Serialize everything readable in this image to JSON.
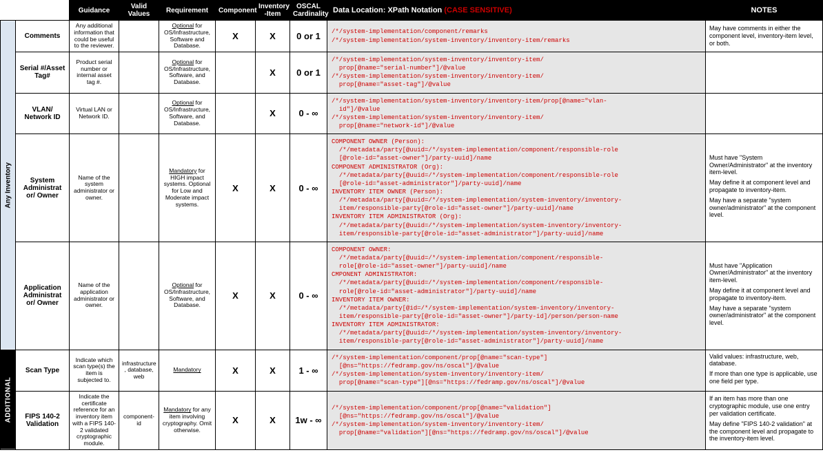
{
  "headers": {
    "guidance": "Guidance",
    "valid": "Valid Values",
    "req": "Requirement",
    "comp": "Component",
    "inv": "Inventory -Item",
    "card": "OSCAL Cardinality",
    "xpath_prefix": "Data Location: XPath Notation ",
    "xpath_cs": "(CASE SENSITIVE)",
    "notes": "NOTES"
  },
  "side": {
    "any": "Any Inventory",
    "add": "ADDITIONAL"
  },
  "rows": {
    "comments": {
      "name": "Comments",
      "guidance": "Any additional information that could be useful to the reviewer.",
      "valid": "",
      "req_u": "Optional",
      "req_rest": " for OS/Infrastructure, Software and Database.",
      "comp": "X",
      "inv": "X",
      "card": "0 or 1",
      "xpath": "/*/system-implementation/component/remarks\n/*/system-implementation/system-inventory/inventory-item/remarks",
      "notes": "May have comments in either the component level, inventory-item level, or both."
    },
    "serial": {
      "name": "Serial #/Asset Tag#",
      "guidance": "Product serial number or internal asset tag #.",
      "valid": "",
      "req_u": "Optional",
      "req_rest": " for OS/Infrastructure, Software, and Database.",
      "comp": "",
      "inv": "X",
      "card": "0 or 1",
      "xpath": "/*/system-implementation/system-inventory/inventory-item/\n  prop[@name=\"serial-number\"]/@value\n/*/system-implementation/system-inventory/inventory-item/\n  prop[@name=\"asset-tag\"]/@value",
      "notes": ""
    },
    "vlan": {
      "name": "VLAN/ Network ID",
      "guidance": "Virtual LAN or Network ID.",
      "valid": "",
      "req_u": "Optional",
      "req_rest": " for OS/Infrastructure, Software, and Database.",
      "comp": "",
      "inv": "X",
      "card": "0 - ∞",
      "xpath": "/*/system-implementation/system-inventory/inventory-item/prop[@name=\"vlan-\n  id\"]/@value\n/*/system-implementation/system-inventory/inventory-item/\n  prop[@name=\"network-id\"]/@value",
      "notes": ""
    },
    "sysadmin": {
      "name": "System Administrat or/ Owner",
      "guidance": "Name of the system administrator or owner.",
      "valid": "",
      "req_u": "Mandatory",
      "req_rest": " for HIGH impact systems. Optional for Low and Moderate impact systems.",
      "comp": "X",
      "inv": "X",
      "card": "0 - ∞",
      "xpath": "COMPONENT OWNER (Person):\n  /*/metadata/party[@uuid=/*/system-implementation/component/responsible-role\n  [@role-id=\"asset-owner\"]/party-uuid]/name\nCOMPONENT ADMINISTRATOR (Org):\n  /*/metadata/party[@uuid=/*/system-implementation/component/responsible-role\n  [@role-id=\"asset-administrator\"]/party-uuid]/name\nINVENTORY ITEM OWNER (Person):\n  /*/metadata/party[@uuid=/*/system-implementation/system-inventory/inventory-\n  item/responsible-party[@role-id=\"asset-owner\"]/party-uuid]/name\nINVENTORY ITEM ADMINISTRATOR (Org):\n  /*/metadata/party[@uuid=/*/system-implementation/system-inventory/inventory-\n  item/responsible-party[@role-id=\"asset-administrator\"]/party-uuid]/name",
      "notes_p1": "Must have \"System Owner/Administrator\" at the inventory item-level.",
      "notes_p2": "May define it at component level and propagate to inventory-item.",
      "notes_p3": "May have a separate \"system owner/administrator\" at the component level."
    },
    "appadmin": {
      "name": "Application Administrat or/ Owner",
      "guidance": "Name of the application administrator or owner.",
      "valid": "",
      "req_u": "Optional",
      "req_rest": " for OS/Infrastructure, Software, and Database.",
      "comp": "X",
      "inv": "X",
      "card": "0 - ∞",
      "xpath": "COMPONENT OWNER:\n  /*/metadata/party[@uuid=/*/system-implementation/component/responsible-\n  role[@role-id=\"asset-owner\"]/party-uuid]/name\nCMPONENT ADMINISTRATOR:\n  /*/metadata/party[@uuid=/*/system-implementation/component/responsible-\n  role[@role-id=\"asset-administrator\"]/party-uuid]/name\nINVENTORY ITEM OWNER:\n  /*/metadata/party[@id=/*/system-implementation/system-inventory/inventory-\n  item/responsible-party[@role-id=\"asset-owner\"]/party-id]/person/person-name\nINVENTORY ITEM ADMINISTRATOR:\n  /*/metadata/party[@uuid=/*/system-implementation/system-inventory/inventory-\n  item/responsible-party[@role-id=\"asset-administrator\"]/party-uuid]/name",
      "notes_p1": "Must have \"Application Owner/Administrator\" at the inventory item-level.",
      "notes_p2": "May define it at component level and propagate to inventory-item.",
      "notes_p3": "May have a separate \"system owner/administrator\" at the component level."
    },
    "scan": {
      "name": "Scan Type",
      "guidance": "Indicate which scan type(s) the item is subjected to.",
      "valid": "infrastructure , database, web",
      "req_u": "Mandatory",
      "req_rest": "",
      "comp": "X",
      "inv": "X",
      "card": "1 - ∞",
      "xpath": "/*/system-implementation/component/prop[@name=\"scan-type\"]\n  [@ns=\"https://fedramp.gov/ns/oscal\"]/@value\n/*/system-implementation/system-inventory/inventory-item/\n  prop[@name=\"scan-type\"][@ns=\"https://fedramp.gov/ns/oscal\"]/@value",
      "notes_p1": "Valid values: infrastructure, web, database.",
      "notes_p2": "If more than one type is applicable, use one field per type."
    },
    "fips": {
      "name": "FIPS 140-2 Validation",
      "guidance": "Indicate the certificate reference for an inventory item with a FIPS 140-2 validated cryptographic module.",
      "valid": "component-id",
      "req_u": "Mandatory",
      "req_rest": " for any item involving cryptography. Omit otherwise.",
      "comp": "X",
      "inv": "X",
      "card": "1w - ∞",
      "xpath": "/*/system-implementation/component/prop[@name=\"validation\"]\n  [@ns=\"https://fedramp.gov/ns/oscal\"]/@value\n/*/system-implementation/system-inventory/inventory-item/\n  prop[@name=\"validation\"][@ns=\"https://fedramp.gov/ns/oscal\"]/@value",
      "notes_p1": "If an item has more than one cryptographic module, use one entry per validation certificate.",
      "notes_p2": "May define \"FIPS 140-2 validation\" at the component level and propagate to the inventory-item level."
    }
  }
}
